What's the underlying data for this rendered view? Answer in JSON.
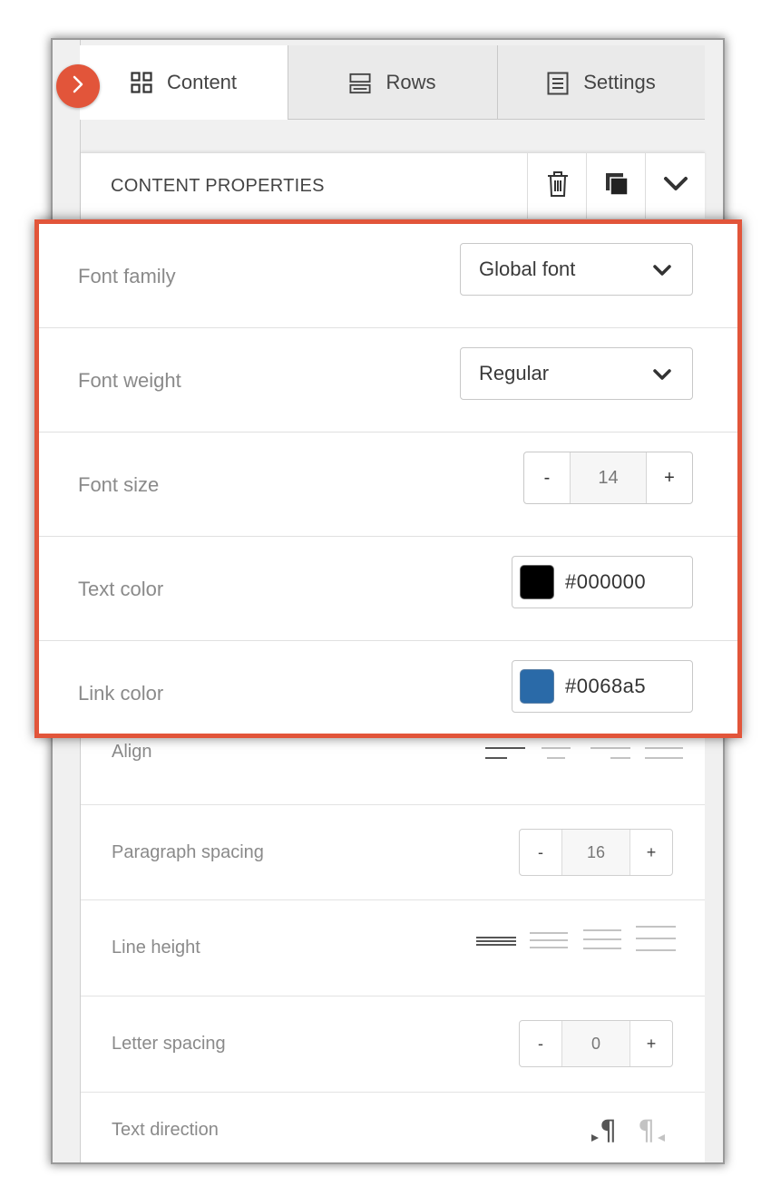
{
  "tabs": [
    {
      "label": "Content",
      "icon": "grid-icon",
      "active": true
    },
    {
      "label": "Rows",
      "icon": "rows-icon",
      "active": false
    },
    {
      "label": "Settings",
      "icon": "settings-list-icon",
      "active": false
    }
  ],
  "content_properties": {
    "title": "CONTENT PROPERTIES",
    "actions": [
      "trash-icon",
      "duplicate-icon",
      "chevron-down-icon"
    ]
  },
  "highlight": {
    "font_family": {
      "label": "Font family",
      "value": "Global font"
    },
    "font_weight": {
      "label": "Font weight",
      "value": "Regular"
    },
    "font_size": {
      "label": "Font size",
      "value": "14",
      "minus": "-",
      "plus": "+"
    },
    "text_color": {
      "label": "Text color",
      "value": "#000000",
      "swatch": "#000000"
    },
    "link_color": {
      "label": "Link color",
      "value": "#0068a5",
      "swatch": "#2a6aa8"
    },
    "border_color": "#e2553a"
  },
  "lower": {
    "align": {
      "label": "Align"
    },
    "paragraph_spacing": {
      "label": "Paragraph spacing",
      "value": "16",
      "minus": "-",
      "plus": "+"
    },
    "line_height": {
      "label": "Line height"
    },
    "letter_spacing": {
      "label": "Letter spacing",
      "value": "0",
      "minus": "-",
      "plus": "+"
    },
    "text_direction": {
      "label": "Text direction"
    }
  },
  "accent": "#e2553a"
}
